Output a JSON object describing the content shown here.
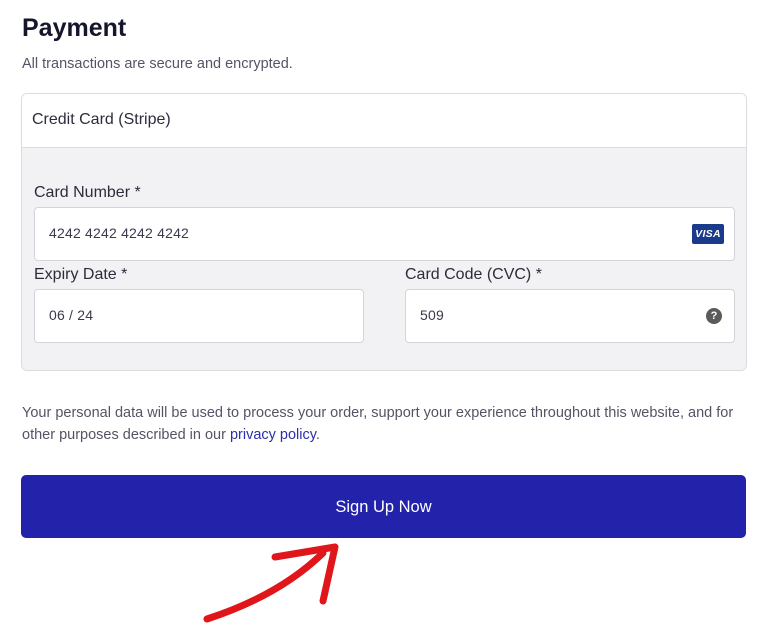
{
  "header": {
    "title": "Payment",
    "subtitle": "All transactions are secure and encrypted."
  },
  "payment_method": {
    "label": "Credit Card (Stripe)"
  },
  "card_number": {
    "label": "Card Number *",
    "value": "4242 4242 4242 4242",
    "brand_badge": "VISA"
  },
  "expiry": {
    "label": "Expiry Date *",
    "value": "06 / 24"
  },
  "cvc": {
    "label": "Card Code (CVC) *",
    "value": "509",
    "help_glyph": "?"
  },
  "privacy": {
    "text_before": "Your personal data will be used to process your order, support your experience throughout this website, and for other purposes described in our ",
    "link_text": "privacy policy",
    "text_after": "."
  },
  "submit": {
    "label": "Sign Up Now"
  },
  "colors": {
    "button": "#2222aa",
    "link": "#2e2ea8",
    "annotation_arrow": "#e0161b",
    "visa": "#1a3a8a"
  },
  "icons": {
    "card_brand": "visa-icon",
    "cvc_help": "question-circle-icon",
    "annotation": "curved-arrow-icon"
  }
}
